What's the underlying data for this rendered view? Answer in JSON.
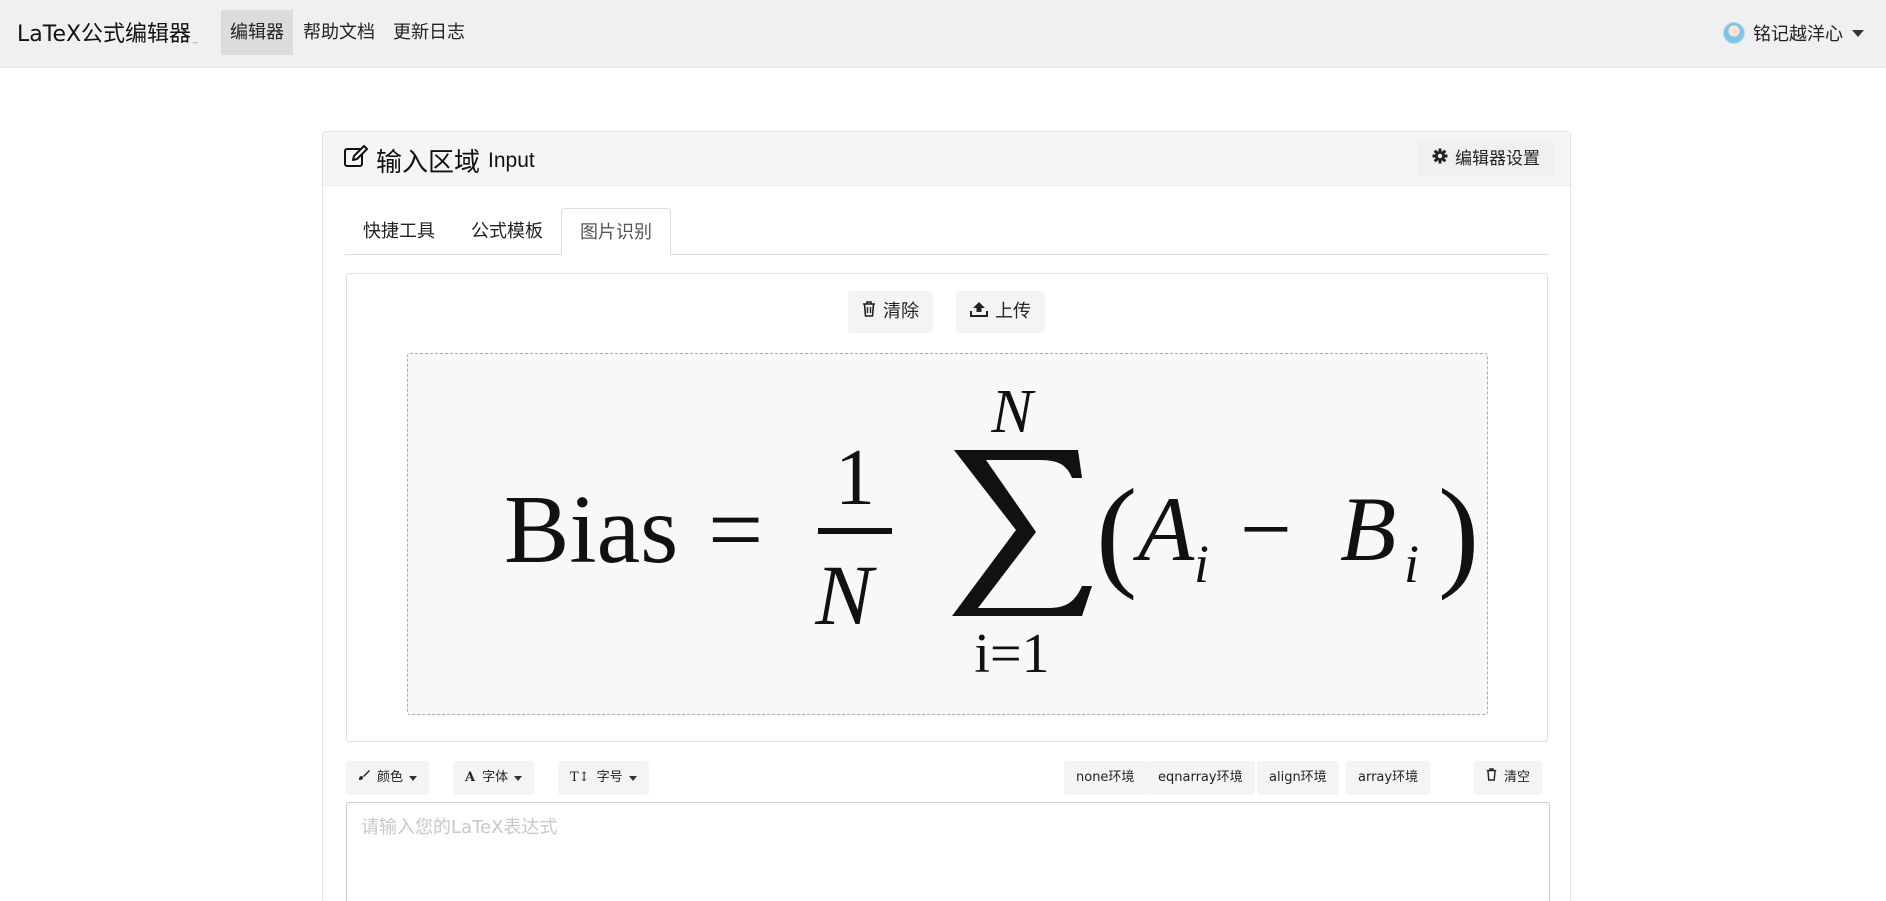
{
  "navbar": {
    "brand": "LaTeX公式编辑器",
    "brand_sub": "_",
    "items": [
      {
        "label": "编辑器",
        "active": true
      },
      {
        "label": "帮助文档",
        "active": false
      },
      {
        "label": "更新日志",
        "active": false
      }
    ],
    "user_name": "铭记越洋心"
  },
  "input_card": {
    "title": "输入区域",
    "title_en": "Input",
    "settings_label": "编辑器设置",
    "tabs": [
      {
        "label": "快捷工具",
        "active": false
      },
      {
        "label": "公式模板",
        "active": false
      },
      {
        "label": "图片识别",
        "active": true
      }
    ],
    "ocr": {
      "clear_label": "清除",
      "upload_label": "上传",
      "formula_image": {
        "lhs": "Bias",
        "equals": "=",
        "fraction_numerator": "1",
        "fraction_denominator": "N",
        "sum_upper": "N",
        "sum_lower": "i=1",
        "term_a": "A",
        "term_b": "B",
        "subscript": "i",
        "minus": "−"
      }
    },
    "toolbar": {
      "color_label": "颜色",
      "font_label": "字体",
      "size_label": "字号",
      "env_buttons": [
        "none环境",
        "eqnarray环境",
        "align环境",
        "array环境"
      ],
      "clear_label": "清空"
    },
    "editor": {
      "placeholder": "请输入您的LaTeX表达式",
      "value": ""
    }
  },
  "colors": {
    "navbar_bg": "#f0f0f0",
    "active_nav_bg": "#dcdcdc",
    "card_header_bg": "#f5f5f5",
    "drop_zone_bg": "#f8f8f8"
  }
}
